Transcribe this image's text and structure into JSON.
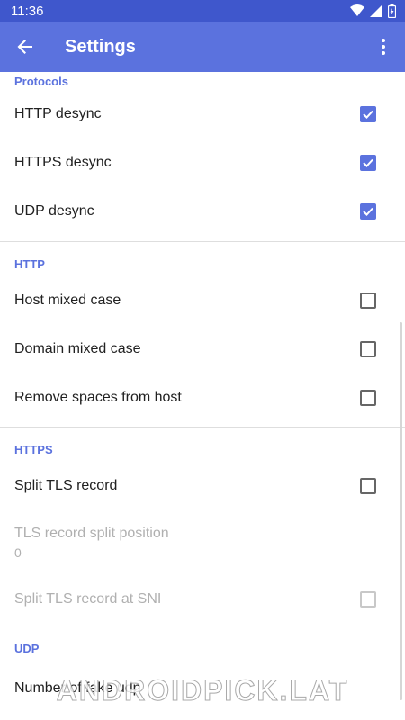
{
  "status": {
    "time": "11:36"
  },
  "app_bar": {
    "title": "Settings"
  },
  "sections": {
    "protocols": {
      "header": "Protocols",
      "items": [
        {
          "label": "HTTP desync",
          "checked": true
        },
        {
          "label": "HTTPS desync",
          "checked": true
        },
        {
          "label": "UDP desync",
          "checked": true
        }
      ]
    },
    "http": {
      "header": "HTTP",
      "items": [
        {
          "label": "Host mixed case",
          "checked": false
        },
        {
          "label": "Domain mixed case",
          "checked": false
        },
        {
          "label": "Remove spaces from host",
          "checked": false
        }
      ]
    },
    "https": {
      "header": "HTTPS",
      "items": [
        {
          "label": "Split TLS record",
          "checked": false
        },
        {
          "label": "TLS record split position",
          "value": "0",
          "enabled": false
        },
        {
          "label": "Split TLS record at SNI",
          "checked": false,
          "enabled": false
        }
      ]
    },
    "udp": {
      "header": "UDP",
      "items": [
        {
          "label": "Number of fake udp"
        }
      ]
    }
  },
  "watermark": "ANDROIDPICK.LAT",
  "colors": {
    "accent": "#5b72de",
    "status_bar": "#3f57cc"
  },
  "icons": [
    "back-arrow-icon",
    "more-vert-icon",
    "wifi-icon",
    "signal-icon",
    "battery-icon",
    "check-icon"
  ]
}
